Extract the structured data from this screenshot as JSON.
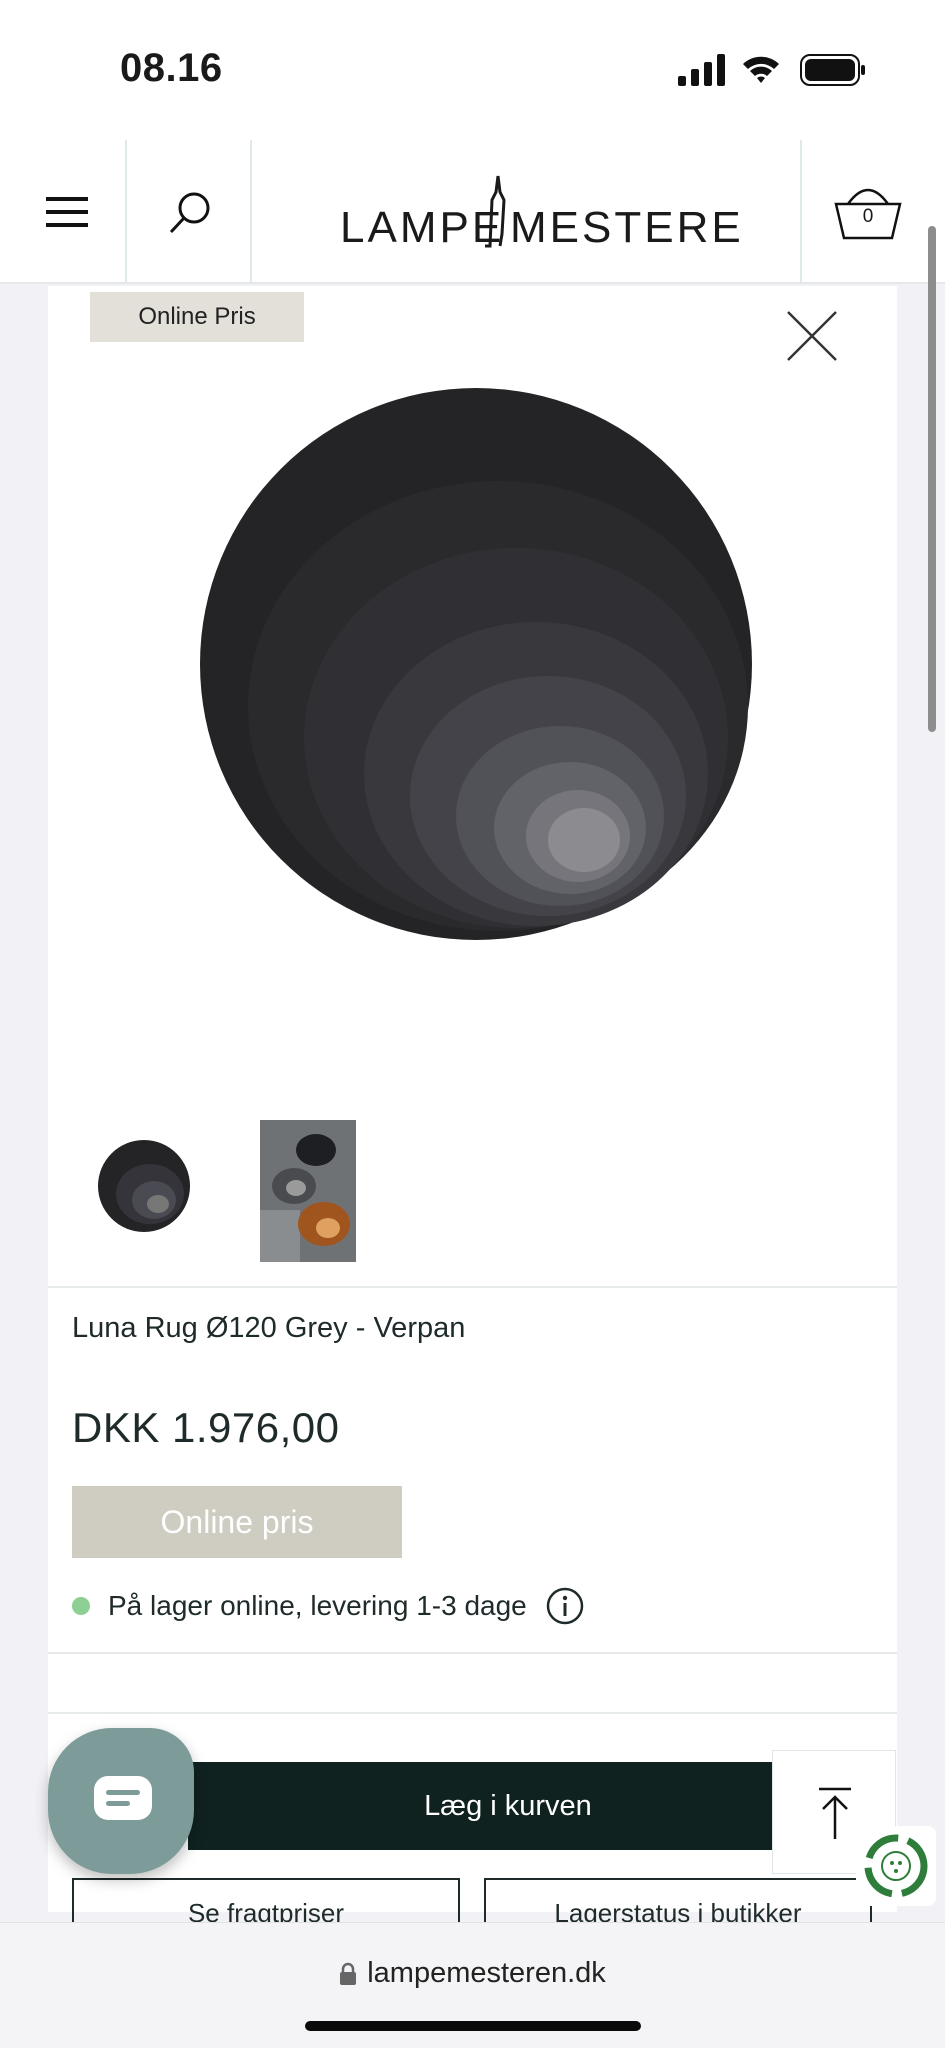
{
  "status_bar": {
    "time": "08.16"
  },
  "header": {
    "logo_text": "LAMPEMESTEREN",
    "cart_count": "0"
  },
  "product": {
    "badge": "Online Pris",
    "title": "Luna Rug Ø120 Grey - Verpan",
    "price": "DKK 1.976,00",
    "online_price_label": "Online pris",
    "stock_text": "På lager online, levering 1-3 dage",
    "stock_color": "#8ecf93"
  },
  "actions": {
    "add_to_cart": "Læg i kurven",
    "freight_prices": "Se fragtpriser",
    "store_stock": "Lagerstatus i butikker"
  },
  "browser": {
    "url": "lampemesteren.dk"
  },
  "colors": {
    "accent_dark": "#0f2220",
    "chat_button": "#7c9b99",
    "badge_bg": "#e3e0da",
    "online_price_bg": "#cfccc1"
  },
  "icons": [
    "signal-icon",
    "wifi-icon",
    "battery-icon",
    "hamburger-menu-icon",
    "search-icon",
    "cart-icon",
    "close-icon",
    "info-icon",
    "chat-icon",
    "arrow-up-icon",
    "recycle-icon",
    "lock-icon"
  ]
}
